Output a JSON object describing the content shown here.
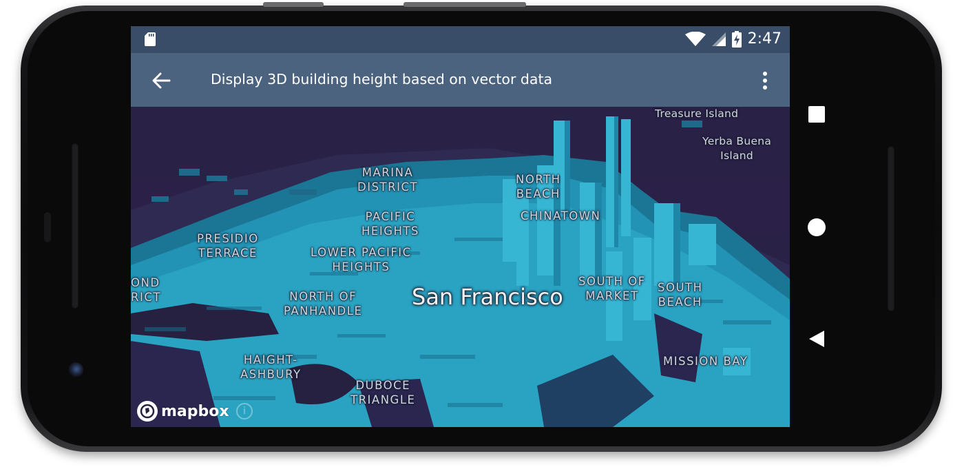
{
  "status_bar": {
    "time": "2:47",
    "icons": [
      "sd-card-icon",
      "wifi-icon",
      "signal-icon",
      "battery-charging-icon"
    ]
  },
  "app_bar": {
    "title": "Display 3D building height based on vector data",
    "back_icon": "arrow-back-icon",
    "overflow_icon": "more-vertical-icon"
  },
  "map": {
    "city_label": "San Francisco",
    "labels": [
      {
        "id": "treasure-island",
        "text": "Treasure Island"
      },
      {
        "id": "yerba-buena",
        "text": "Yerba Buena\nIsland"
      },
      {
        "id": "marina",
        "text": "MARINA\nDISTRICT"
      },
      {
        "id": "north-beach",
        "text": "NORTH\nBEACH"
      },
      {
        "id": "chinatown",
        "text": "CHINATOWN"
      },
      {
        "id": "pacific-heights",
        "text": "PACIFIC\nHEIGHTS"
      },
      {
        "id": "presidio-terrace",
        "text": "PRESIDIO\nTERRACE"
      },
      {
        "id": "lower-pacific-heights",
        "text": "LOWER PACIFIC\nHEIGHTS"
      },
      {
        "id": "richmond-district",
        "text": "OND\nRICT"
      },
      {
        "id": "north-of-panhandle",
        "text": "NORTH OF\nPANHANDLE"
      },
      {
        "id": "south-of-market",
        "text": "SOUTH OF\nMARKET"
      },
      {
        "id": "south-beach",
        "text": "SOUTH\nBEACH"
      },
      {
        "id": "haight-ashbury",
        "text": "HAIGHT-\nASHBURY"
      },
      {
        "id": "duboce-triangle",
        "text": "DUBOCE\nTRIANGLE"
      },
      {
        "id": "mission-bay",
        "text": "MISSION BAY"
      }
    ],
    "attribution": {
      "logo_text": "mapbox",
      "info_label": "i"
    }
  },
  "colors": {
    "status_bar": "#3a4d68",
    "app_bar": "#4c6380",
    "map_background": "#262041",
    "buildings": "#2aa3c2",
    "buildings_shade": "#1b7594"
  },
  "nav_bar": {
    "icons": [
      "recents-square-icon",
      "home-circle-icon",
      "back-triangle-icon"
    ]
  }
}
